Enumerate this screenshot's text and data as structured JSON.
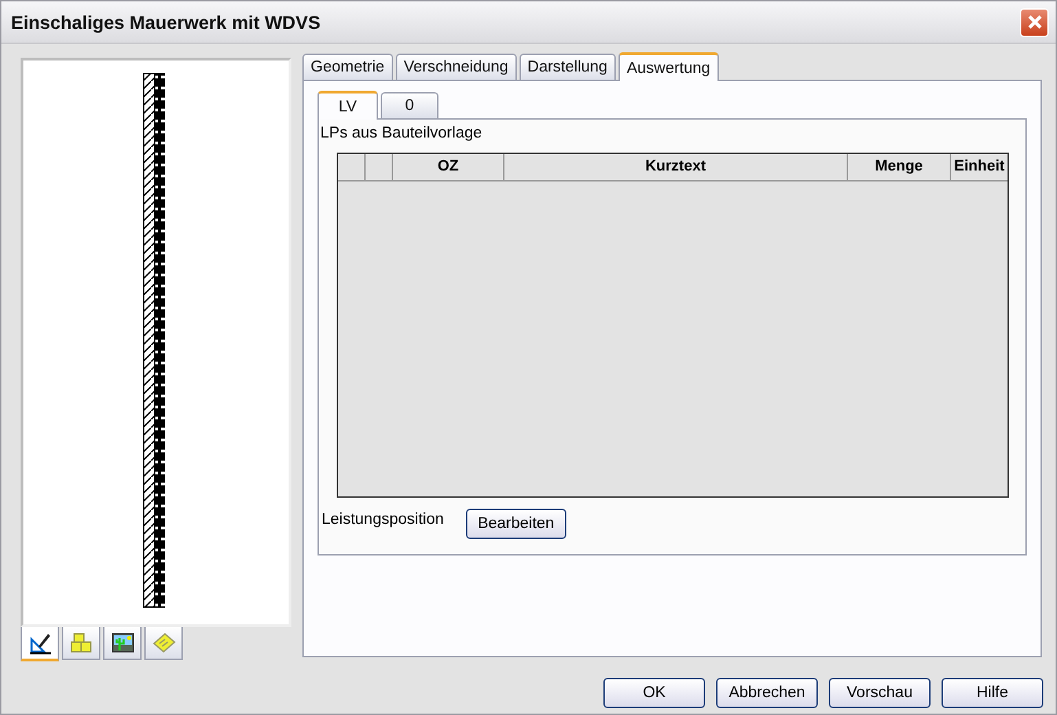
{
  "window": {
    "title": "Einschaliges Mauerwerk mit WDVS"
  },
  "preview_tabs": [
    {
      "kind": "drafting",
      "selected": true
    },
    {
      "kind": "blocks",
      "selected": false
    },
    {
      "kind": "image",
      "selected": false
    },
    {
      "kind": "note",
      "selected": false
    }
  ],
  "tabs": [
    {
      "label": "Geometrie",
      "selected": false
    },
    {
      "label": "Verschneidung",
      "selected": false
    },
    {
      "label": "Darstellung",
      "selected": false
    },
    {
      "label": "Auswertung",
      "selected": true
    }
  ],
  "subtabs": [
    {
      "label": "LV",
      "selected": true
    },
    {
      "label": "0",
      "selected": false
    }
  ],
  "group_label": "LPs aus Bauteilvorlage",
  "table": {
    "columns": [
      {
        "kind": "blank"
      },
      {
        "kind": "blank"
      },
      {
        "kind": "text",
        "label": "OZ"
      },
      {
        "kind": "text",
        "label": "Kurztext"
      },
      {
        "kind": "text",
        "label": "Menge"
      },
      {
        "kind": "text",
        "label": "Einheit"
      }
    ]
  },
  "field": {
    "label": "Leistungsposition",
    "button": "Bearbeiten"
  },
  "buttons": [
    "OK",
    "Abbrechen",
    "Vorschau",
    "Hilfe"
  ]
}
